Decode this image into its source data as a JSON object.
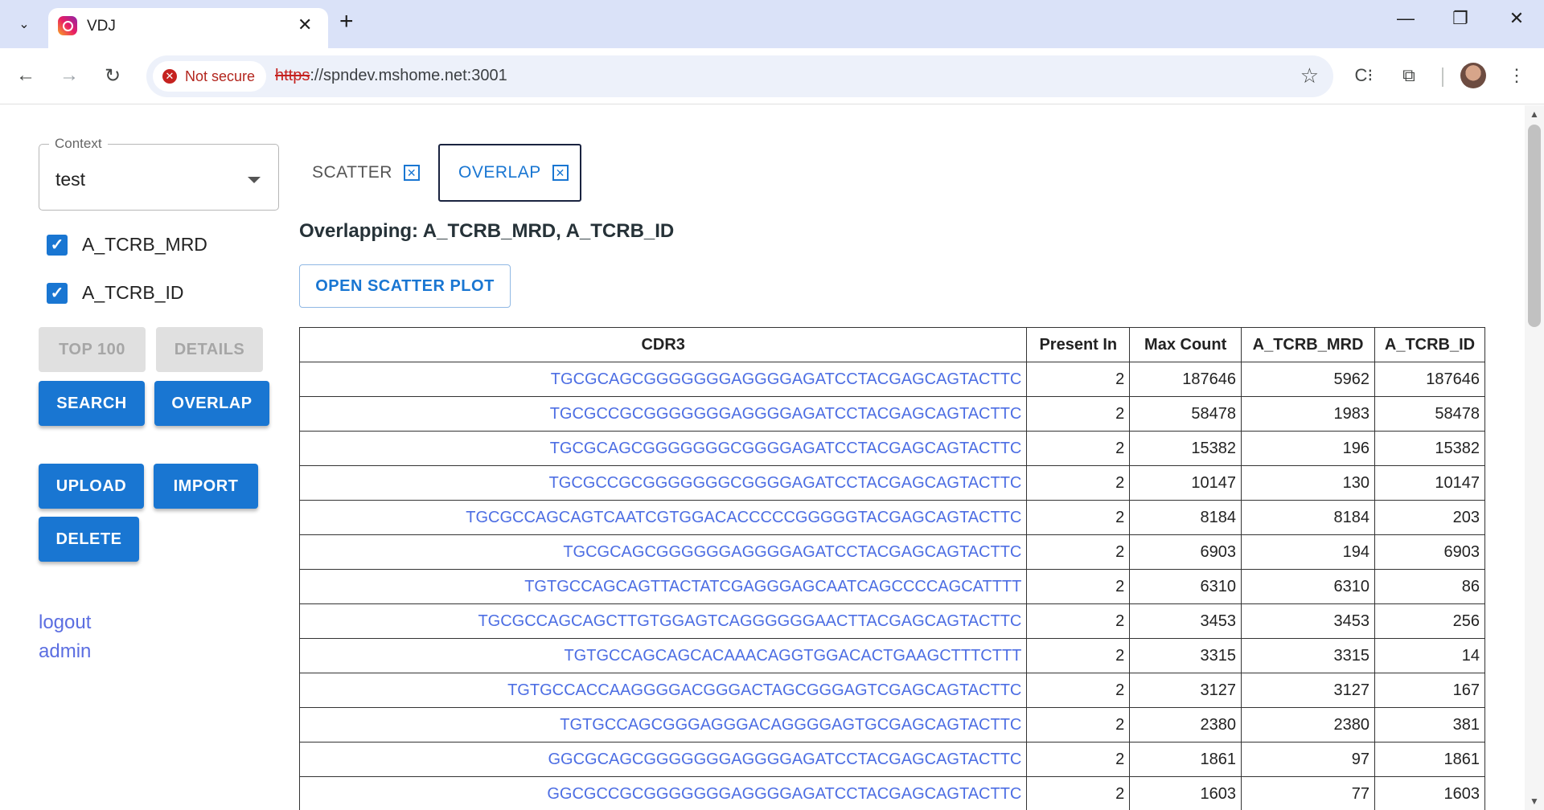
{
  "browser": {
    "tab_title": "VDJ",
    "not_secure_label": "Not secure",
    "url_scheme": "https",
    "url_rest": "://spndev.mshome.net:3001"
  },
  "sidebar": {
    "context_label": "Context",
    "context_value": "test",
    "checkboxes": [
      {
        "label": "A_TCRB_MRD",
        "checked": true
      },
      {
        "label": "A_TCRB_ID",
        "checked": true
      }
    ],
    "buttons": {
      "top100": "TOP 100",
      "details": "DETAILS",
      "search": "SEARCH",
      "overlap": "OVERLAP",
      "upload": "UPLOAD",
      "import": "IMPORT",
      "delete": "DELETE"
    },
    "links": {
      "logout": "logout",
      "admin": "admin"
    }
  },
  "main": {
    "tabs": [
      {
        "label": "SCATTER",
        "active": false
      },
      {
        "label": "OVERLAP",
        "active": true
      }
    ],
    "title": "Overlapping: A_TCRB_MRD, A_TCRB_ID",
    "open_scatter_label": "OPEN SCATTER PLOT",
    "table": {
      "headers": [
        "CDR3",
        "Present In",
        "Max Count",
        "A_TCRB_MRD",
        "A_TCRB_ID"
      ],
      "rows": [
        [
          "TGCGCAGCGGGGGGGAGGGGAGATCCTACGAGCAGTACTTC",
          "2",
          "187646",
          "5962",
          "187646"
        ],
        [
          "TGCGCCGCGGGGGGGAGGGGAGATCCTACGAGCAGTACTTC",
          "2",
          "58478",
          "1983",
          "58478"
        ],
        [
          "TGCGCAGCGGGGGGGCGGGGAGATCCTACGAGCAGTACTTC",
          "2",
          "15382",
          "196",
          "15382"
        ],
        [
          "TGCGCCGCGGGGGGGCGGGGAGATCCTACGAGCAGTACTTC",
          "2",
          "10147",
          "130",
          "10147"
        ],
        [
          "TGCGCCAGCAGTCAATCGTGGACACCCCCGGGGGTACGAGCAGTACTTC",
          "2",
          "8184",
          "8184",
          "203"
        ],
        [
          "TGCGCAGCGGGGGGAGGGGAGATCCTACGAGCAGTACTTC",
          "2",
          "6903",
          "194",
          "6903"
        ],
        [
          "TGTGCCAGCAGTTACTATCGAGGGAGCAATCAGCCCCAGCATTTT",
          "2",
          "6310",
          "6310",
          "86"
        ],
        [
          "TGCGCCAGCAGCTTGTGGAGTCAGGGGGGAACTTACGAGCAGTACTTC",
          "2",
          "3453",
          "3453",
          "256"
        ],
        [
          "TGTGCCAGCAGCACAAACAGGTGGACACTGAAGCTTTCTTT",
          "2",
          "3315",
          "3315",
          "14"
        ],
        [
          "TGTGCCACCAAGGGGACGGGACTAGCGGGAGTCGAGCAGTACTTC",
          "2",
          "3127",
          "3127",
          "167"
        ],
        [
          "TGTGCCAGCGGGAGGGACAGGGGAGTGCGAGCAGTACTTC",
          "2",
          "2380",
          "2380",
          "381"
        ],
        [
          "GGCGCAGCGGGGGGGAGGGGAGATCCTACGAGCAGTACTTC",
          "2",
          "1861",
          "97",
          "1861"
        ],
        [
          "GGCGCCGCGGGGGGGAGGGGAGATCCTACGAGCAGTACTTC",
          "2",
          "1603",
          "77",
          "1603"
        ]
      ]
    }
  },
  "colors": {
    "primary": "#1976d2",
    "link": "#5b6ee1",
    "cdr_text": "#4d6ee3",
    "tabstrip": "#dae2f8"
  }
}
